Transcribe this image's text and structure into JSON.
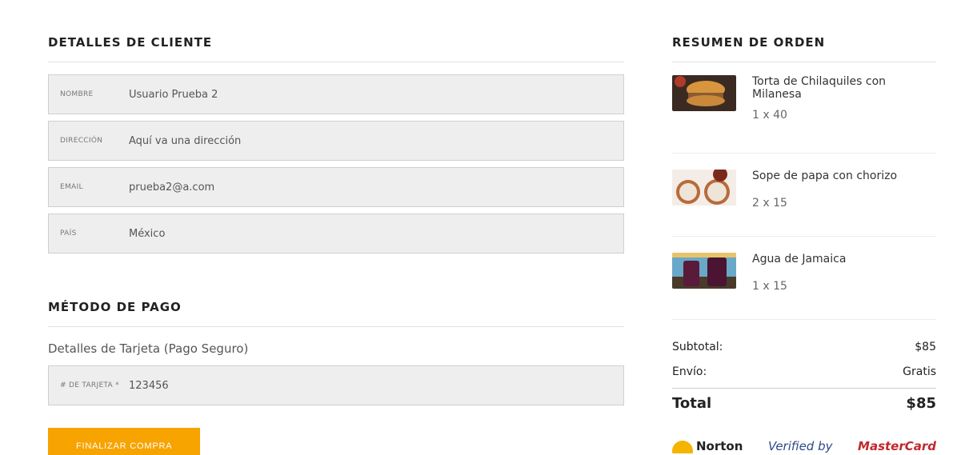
{
  "customer": {
    "title": "DETALLES DE CLIENTE",
    "fields": [
      {
        "label": "NOMBRE",
        "value": "Usuario Prueba 2"
      },
      {
        "label": "DIRECCIÓN",
        "value": "Aquí va una dirección"
      },
      {
        "label": "EMAIL",
        "value": "prueba2@a.com"
      },
      {
        "label": "PAÍS",
        "value": "México"
      }
    ]
  },
  "payment": {
    "title": "MÉTODO DE PAGO",
    "subtitle": "Detalles de Tarjeta (Pago Seguro)",
    "card_label": "# DE TARJETA *",
    "card_value": "123456",
    "submit_label": "FINALIZAR COMPRA",
    "accent_color": "#f7a300"
  },
  "summary": {
    "title": "RESUMEN DE ORDEN",
    "items": [
      {
        "name": "Torta de Chilaquiles con Milanesa",
        "qty": "1 x 40",
        "image": "torta-thumbnail"
      },
      {
        "name": "Sope de papa con chorizo",
        "qty": "2 x 15",
        "image": "sope-thumbnail"
      },
      {
        "name": "Agua de Jamaica",
        "qty": "1 x 15",
        "image": "agua-thumbnail"
      }
    ],
    "subtotal_label": "Subtotal:",
    "subtotal_value": "$85",
    "shipping_label": "Envío:",
    "shipping_value": "Gratis",
    "total_label": "Total",
    "total_value": "$85",
    "badges": [
      "Norton",
      "Verified by",
      "MasterCard"
    ]
  }
}
